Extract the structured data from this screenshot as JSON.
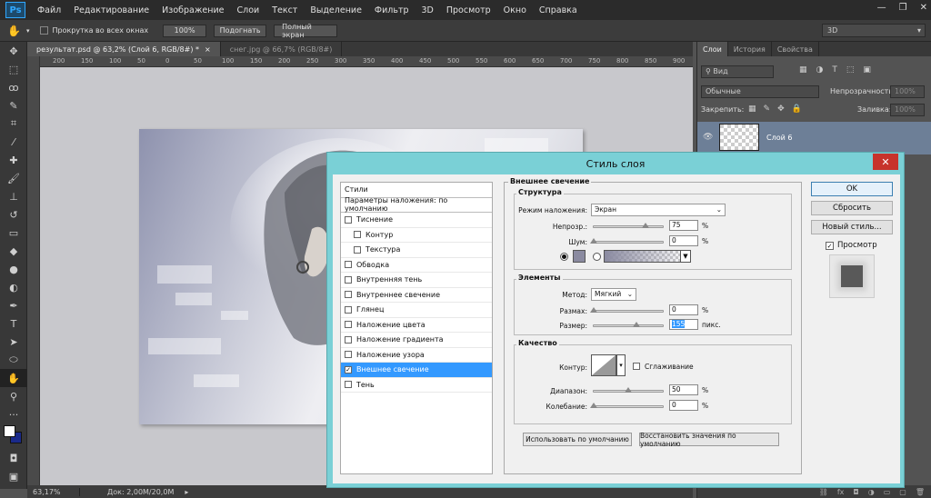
{
  "app": {
    "logo": "Ps"
  },
  "menu": [
    "Файл",
    "Редактирование",
    "Изображение",
    "Слои",
    "Текст",
    "Выделение",
    "Фильтр",
    "3D",
    "Просмотр",
    "Окно",
    "Справка"
  ],
  "options": {
    "scroll_all_label": "Прокрутка во всех окнах",
    "zoom_btn": "100%",
    "fit_btn": "Подогнать",
    "fullscreen_btn": "Полный экран",
    "workspace": "3D"
  },
  "doc_tabs": [
    {
      "label": "результат.psd @ 63,2% (Слой 6, RGB/8#) *",
      "active": true
    },
    {
      "label": "снег.jpg @ 66,7% (RGB/8#)",
      "active": false
    }
  ],
  "ruler_ticks": [
    "200",
    "150",
    "100",
    "50",
    "0",
    "50",
    "100",
    "150",
    "200",
    "250",
    "300",
    "350",
    "400",
    "450",
    "500",
    "550",
    "600",
    "650",
    "700",
    "750",
    "800",
    "850",
    "900"
  ],
  "status": {
    "zoom": "63,17%",
    "doc": "Док: 2,00M/20,0M"
  },
  "layers_panel": {
    "tabs": [
      "Слои",
      "История",
      "Свойства"
    ],
    "kind": "Вид",
    "blend": "Обычные",
    "opacity_label": "Непрозрачность:",
    "opacity_value": "100%",
    "lock_label": "Закрепить:",
    "fill_label": "Заливка:",
    "fill_value": "100%",
    "layer_name": "Слой 6"
  },
  "dialog": {
    "title": "Стиль слоя",
    "styles_header": "Стили",
    "blend_defaults": "Параметры наложения: по умолчанию",
    "styles": [
      {
        "label": "Тиснение",
        "checked": false,
        "sub": false
      },
      {
        "label": "Контур",
        "checked": false,
        "sub": true
      },
      {
        "label": "Текстура",
        "checked": false,
        "sub": true
      },
      {
        "label": "Обводка",
        "checked": false,
        "sub": false
      },
      {
        "label": "Внутренняя тень",
        "checked": false,
        "sub": false
      },
      {
        "label": "Внутреннее свечение",
        "checked": false,
        "sub": false
      },
      {
        "label": "Глянец",
        "checked": false,
        "sub": false
      },
      {
        "label": "Наложение цвета",
        "checked": false,
        "sub": false
      },
      {
        "label": "Наложение градиента",
        "checked": false,
        "sub": false
      },
      {
        "label": "Наложение узора",
        "checked": false,
        "sub": false
      },
      {
        "label": "Внешнее свечение",
        "checked": true,
        "sub": false,
        "selected": true
      },
      {
        "label": "Тень",
        "checked": false,
        "sub": false
      }
    ],
    "section_title": "Внешнее свечение",
    "structure": {
      "title": "Структура",
      "blend_label": "Режим наложения:",
      "blend_value": "Экран",
      "opacity_label": "Непрозр.:",
      "opacity_value": "75",
      "opacity_frac": 0.75,
      "noise_label": "Шум:",
      "noise_value": "0",
      "noise_frac": 0,
      "glow_color": "#8a8aa0",
      "unit": "%"
    },
    "elements": {
      "title": "Элементы",
      "method_label": "Метод:",
      "method_value": "Мягкий",
      "spread_label": "Размах:",
      "spread_value": "0",
      "spread_frac": 0,
      "size_label": "Размер:",
      "size_value": "155",
      "size_frac": 0.62,
      "size_unit": "пикс.",
      "unit": "%"
    },
    "quality": {
      "title": "Качество",
      "contour_label": "Контур:",
      "antialias_label": "Сглаживание",
      "range_label": "Диапазон:",
      "range_value": "50",
      "range_frac": 0.5,
      "jitter_label": "Колебание:",
      "jitter_value": "0",
      "jitter_frac": 0,
      "unit": "%"
    },
    "make_default": "Использовать по умолчанию",
    "reset_default": "Восстановить значения по умолчанию",
    "ok": "OK",
    "cancel": "Сбросить",
    "new_style": "Новый стиль...",
    "preview_label": "Просмотр"
  }
}
